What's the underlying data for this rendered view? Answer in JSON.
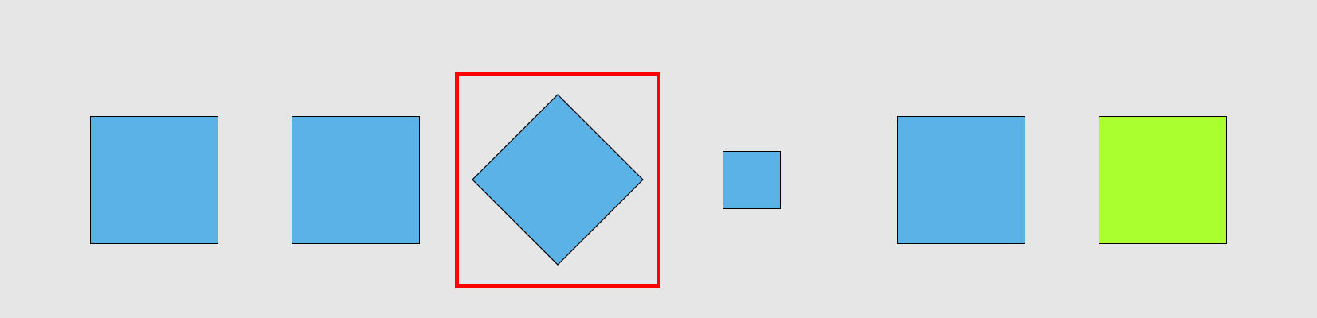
{
  "colors": {
    "background": "#e6e6e6",
    "shape_fill_blue": "#5ab2e6",
    "shape_fill_green": "#aaff2f",
    "shape_stroke": "#000000",
    "highlight_stroke": "#ff0000"
  },
  "shapes": [
    {
      "kind": "square",
      "fill_key": "shape_fill_blue"
    },
    {
      "kind": "square",
      "fill_key": "shape_fill_blue"
    },
    {
      "kind": "diamond",
      "fill_key": "shape_fill_blue",
      "highlighted": true
    },
    {
      "kind": "small-square",
      "fill_key": "shape_fill_blue"
    },
    {
      "kind": "square",
      "fill_key": "shape_fill_blue"
    },
    {
      "kind": "square",
      "fill_key": "shape_fill_green"
    }
  ]
}
